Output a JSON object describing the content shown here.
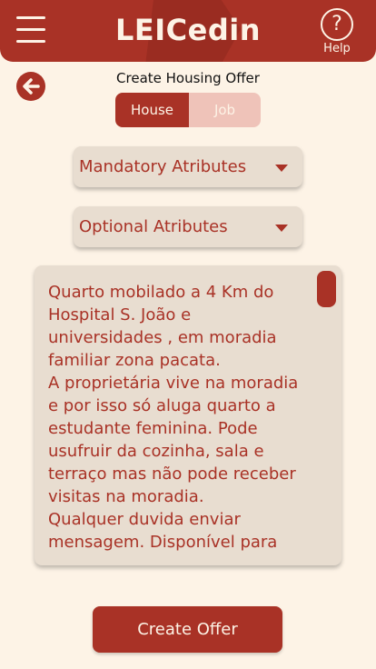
{
  "header": {
    "title": "LEICedin",
    "help_label": "Help",
    "help_glyph": "?",
    "bg_color": "#a93226"
  },
  "page": {
    "title": "Create Housing Offer"
  },
  "toggle": {
    "house": "House",
    "job": "Job",
    "selected": "House"
  },
  "dropdowns": {
    "mandatory": "Mandatory Atributes",
    "optional": "Optional Atributes"
  },
  "description": {
    "text": "Quarto mobilado a 4 Km do Hospital S. João e universidades , em moradia familiar zona pacata.\nA proprietária vive na moradia e por isso só aluga quarto a estudante feminina. Pode usufruir da cozinha, sala e terraço mas não pode receber visitas na moradia.\nQualquer duvida enviar mensagem. Disponível para"
  },
  "actions": {
    "create": "Create Offer"
  },
  "icons": {
    "menu": "hamburger-menu-icon",
    "help": "help-circle-icon",
    "back": "back-arrow-icon",
    "dropdown": "caret-down-icon"
  },
  "colors": {
    "primary": "#a93226",
    "background": "#fdf3e6",
    "panel": "#e8ddd0",
    "inactive_toggle": "#efc3b9"
  }
}
